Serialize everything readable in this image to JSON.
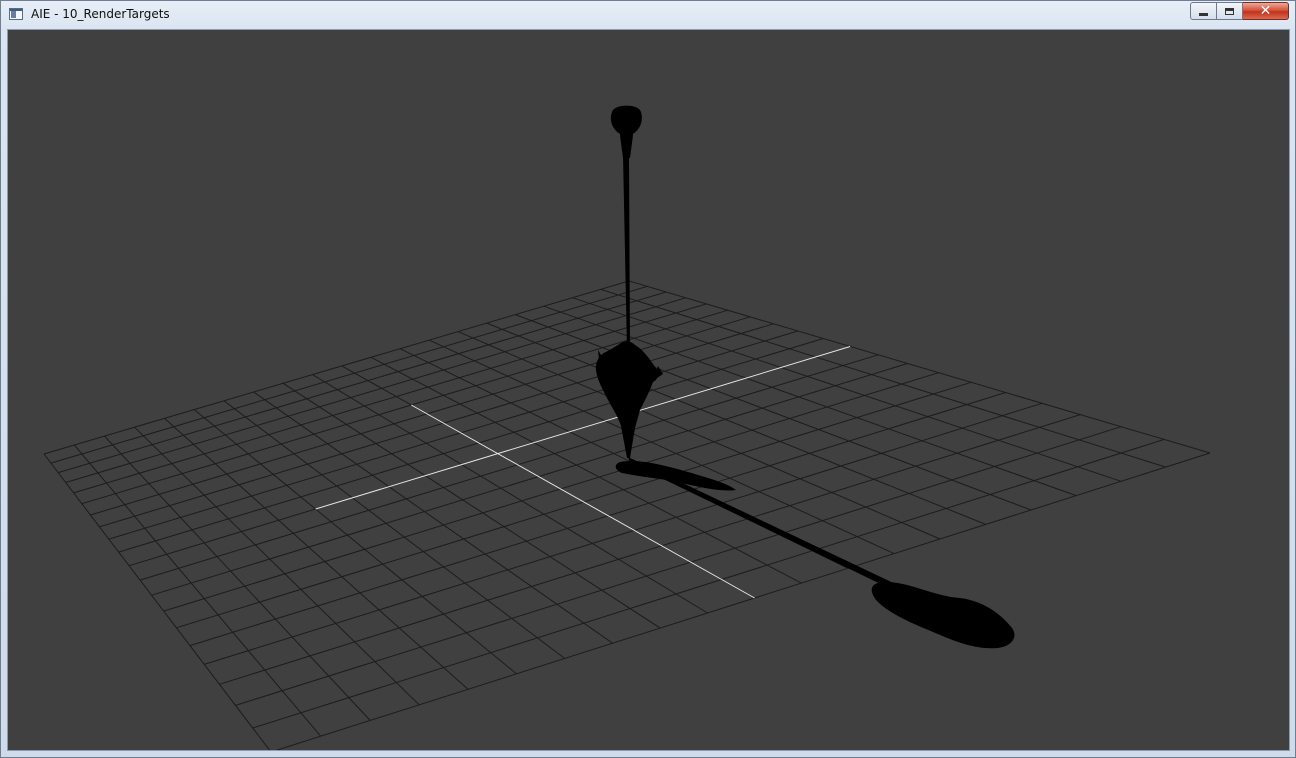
{
  "window": {
    "title": "AIE - 10_RenderTargets",
    "icon": "app-window-icon",
    "controls": {
      "minimize_icon": "minimize-icon",
      "maximize_icon": "maximize-icon",
      "close_label": "✕"
    }
  },
  "scene": {
    "background_color": "#404040",
    "grid_line_color": "#1c1c1c",
    "axis_color": "#e8e8e8",
    "object_color": "#000000",
    "grid_divisions": 20
  }
}
